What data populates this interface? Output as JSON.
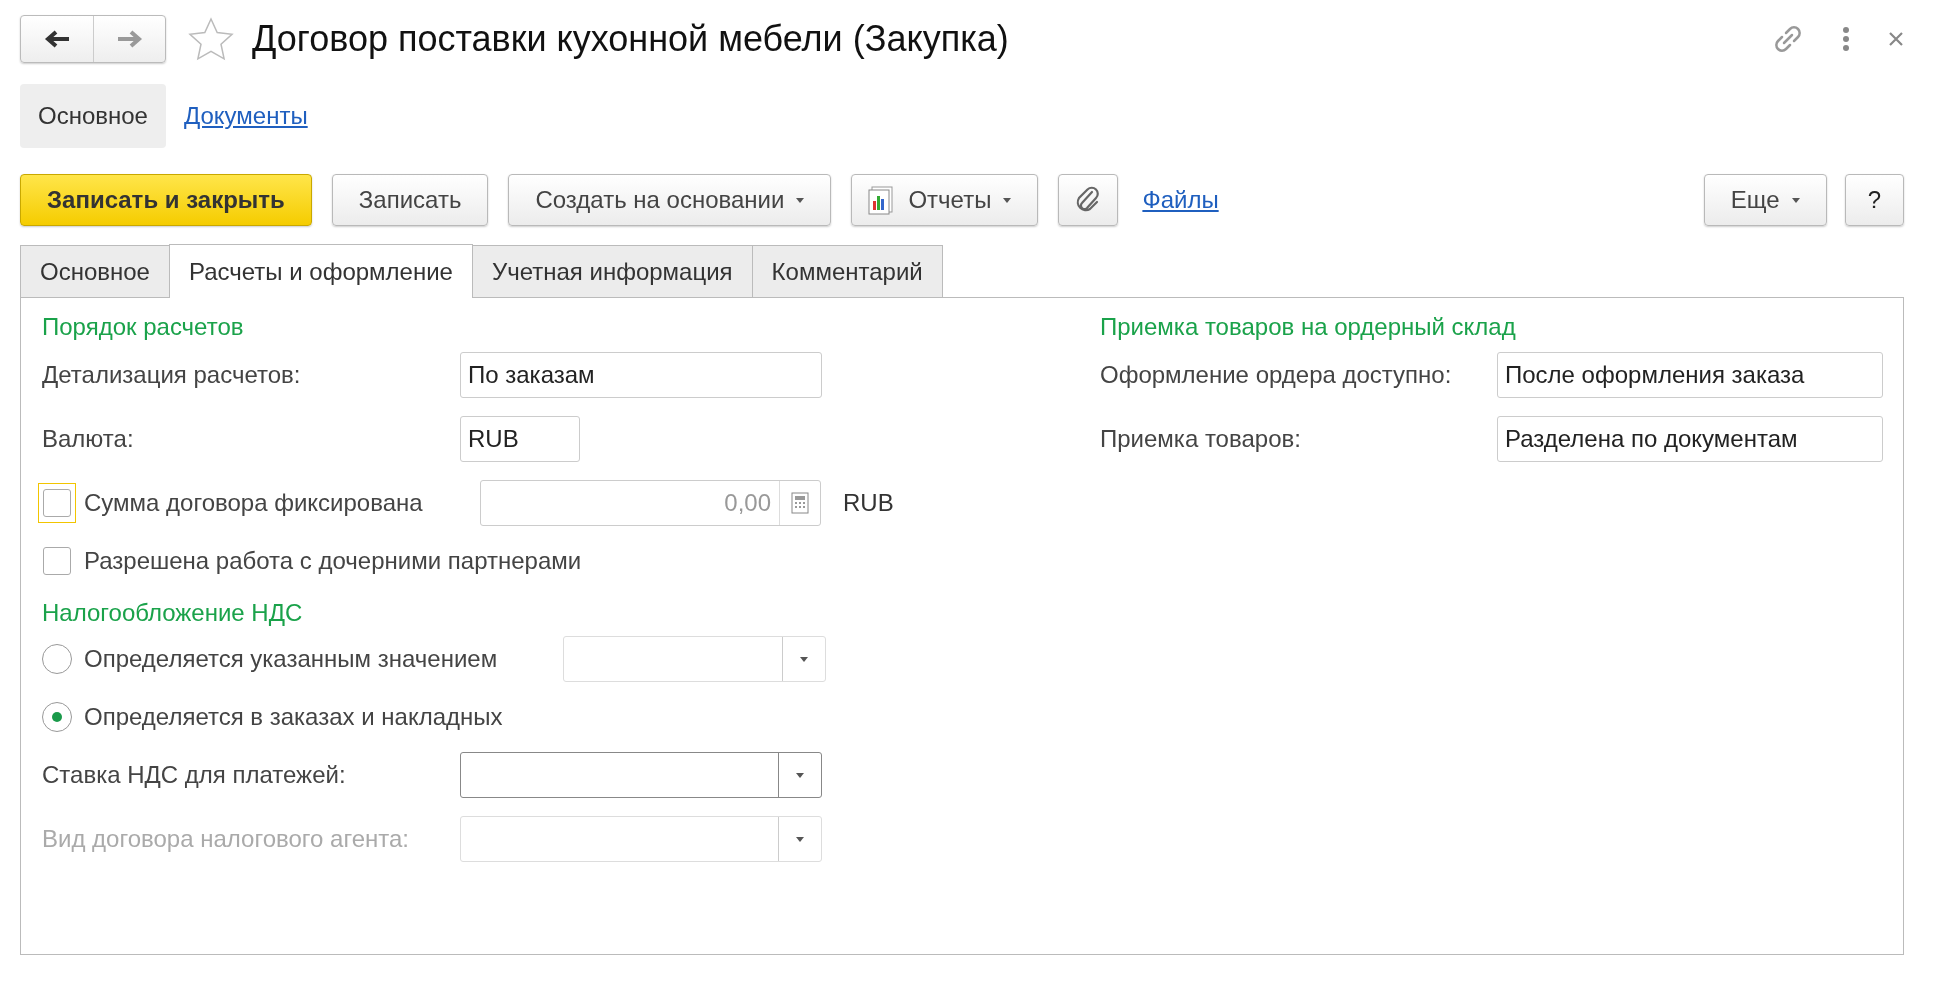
{
  "window": {
    "title": "Договор поставки кухонной мебели (Закупка)",
    "favorite": false
  },
  "nav_tabs": [
    {
      "label": "Основное",
      "selected": true
    },
    {
      "label": "Документы",
      "selected": false
    }
  ],
  "toolbar": {
    "left": [
      {
        "kind": "primary",
        "label": "Записать и закрыть"
      },
      {
        "kind": "plain",
        "label": "Записать"
      },
      {
        "kind": "dropdown",
        "label": "Создать на основании"
      },
      {
        "kind": "report",
        "label": "Отчеты"
      },
      {
        "kind": "attach"
      },
      {
        "kind": "link",
        "label": "Файлы"
      }
    ],
    "right": [
      {
        "kind": "dropdown",
        "label": "Еще"
      },
      {
        "kind": "plain",
        "label": "?"
      }
    ]
  },
  "tabs": [
    {
      "label": "Основное",
      "selected": false
    },
    {
      "label": "Расчеты и оформление",
      "selected": true
    },
    {
      "label": "Учетная информация",
      "selected": false
    },
    {
      "label": "Комментарий",
      "selected": false
    }
  ],
  "left_column": [
    {
      "kind": "group",
      "label": "Порядок расчетов"
    },
    {
      "kind": "field",
      "label": "Детализация расчетов:",
      "value": "По заказам"
    },
    {
      "kind": "short_field",
      "label": "Валюта:",
      "value": "RUB"
    },
    {
      "kind": "amount_checkbox",
      "label": "Сумма договора фиксирована",
      "checked": false,
      "focused": true,
      "amount": "0,00",
      "currency": "RUB"
    },
    {
      "kind": "checkbox",
      "label": "Разрешена работа с дочерними партнерами",
      "checked": false,
      "focused": false
    },
    {
      "kind": "group",
      "label": "Налогообложение НДС"
    },
    {
      "kind": "radio_select",
      "label": "Определяется указанным значением",
      "selected": false
    },
    {
      "kind": "radio",
      "label": "Определяется в заказах и накладных",
      "selected": true
    },
    {
      "kind": "select",
      "label": "Ставка НДС для платежей:",
      "disabled": false
    },
    {
      "kind": "select",
      "label": "Вид договора налогового агента:",
      "disabled": true
    }
  ],
  "right_column": [
    {
      "kind": "group",
      "label": "Приемка товаров на ордерный склад"
    },
    {
      "kind": "field",
      "label": "Оформление ордера доступно:",
      "value": "После оформления заказа"
    },
    {
      "kind": "field",
      "label": "Приемка товаров:",
      "value": "Разделена по документам"
    }
  ]
}
